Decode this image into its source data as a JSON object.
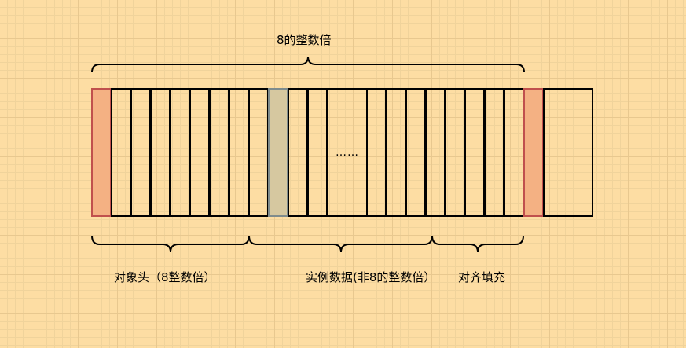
{
  "labels": {
    "top": "8的整数倍",
    "ellipsis": "……",
    "header": "对象头（8整数倍）",
    "instance": "实例数据(非8的整数倍）",
    "padding": "对齐填充"
  },
  "colors": {
    "background": "#fddda3",
    "stroke": "#000000",
    "header_cell": "#f4b183",
    "header_border": "#c0504d",
    "gray_cell": "#d6c8a0",
    "gray_border": "#7f8c8d"
  }
}
